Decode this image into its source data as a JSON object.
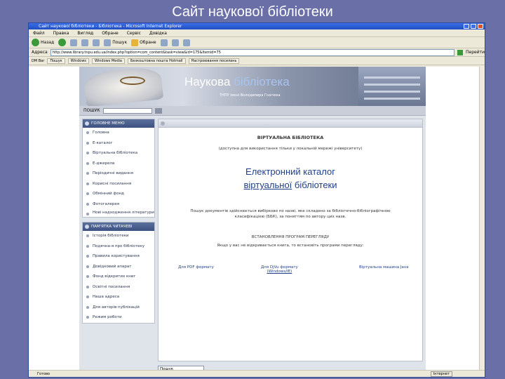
{
  "slide_title": "Сайт наукової бібліотеки",
  "browser": {
    "window_title": "Сайт наукової бібліотеки - Бібліотека - Microsoft Internet Explorer",
    "menu": [
      "Файл",
      "Правка",
      "Вигляд",
      "Обране",
      "Сервіс",
      "Довідка"
    ],
    "toolbar": {
      "back": "Назад",
      "search": "Пошук",
      "favorites": "Обране"
    },
    "address_label": "Адреса",
    "address_value": "http://www.library.tnpu.edu.ua/index.php?option=com_content&task=view&id=175&Itemid=75",
    "go_label": "Перейти",
    "links": [
      "DM Bar",
      "Пошук",
      "Windows",
      "Windows Media",
      "Безкоштовна пошта Hotmail",
      "Настроювання посилань"
    ],
    "status_text": "Готово",
    "status_zone": "Інтернет"
  },
  "site": {
    "banner_title_main": "Наукова ",
    "banner_title_accent": "бібліотека",
    "banner_subtitle": "ТНПУ імені Володимира Гнатюка",
    "search_label": "ПОШУК",
    "main_menu_title": "ГОЛОВНЕ МЕНЮ",
    "main_menu": [
      "Головна",
      "Е-каталог",
      "Віртуальна бібліотека",
      "Е-джерела",
      "Періодичні видання",
      "Корисні посилання",
      "Обмінний фонд",
      "Фотогалерея",
      "Нові надходження літератури"
    ],
    "reader_menu_title": "ПАМ'ЯТКА ЧИТАЧЕВІ",
    "reader_menu": [
      "Історія бібліотеки",
      "Подячна-я про бібліотеку",
      "Правила користування",
      "Довідковий апарат",
      "Фонд відкритих книг",
      "Освітні посилання",
      "Наша адреса",
      "Для авторів публікацій",
      "Режим роботи"
    ],
    "content": {
      "heading": "ВІРТУАЛЬНА БІБЛІОТЕКА",
      "access_note": "(доступна для використання тільки у локальній мережі університету)",
      "catalog_line1": "Електронний каталог",
      "catalog_line2_link": "віртуальної",
      "catalog_line2_rest": " бібліотеки",
      "search_info": "Пошук документів здійснюється вибірково по назві, яке складено за бібліотечно-бібліографічною класифікацією (ББК), за поняттям по автору цих назв.",
      "install_heading": "ВСТАНОВЛЕННЯ ПРОГРАМ ПЕРЕГЛЯДУ",
      "install_note": "Якщо у вас не відкривається книга, то встановіть програми перегляду:",
      "download_pdf": "Для PDF формату",
      "download_djvu": "Для DjVu формату",
      "download_djvu_sub": "(Windows/IE)",
      "download_java": "Віртуальна машина Java"
    },
    "bottom_search": "Пошук"
  }
}
